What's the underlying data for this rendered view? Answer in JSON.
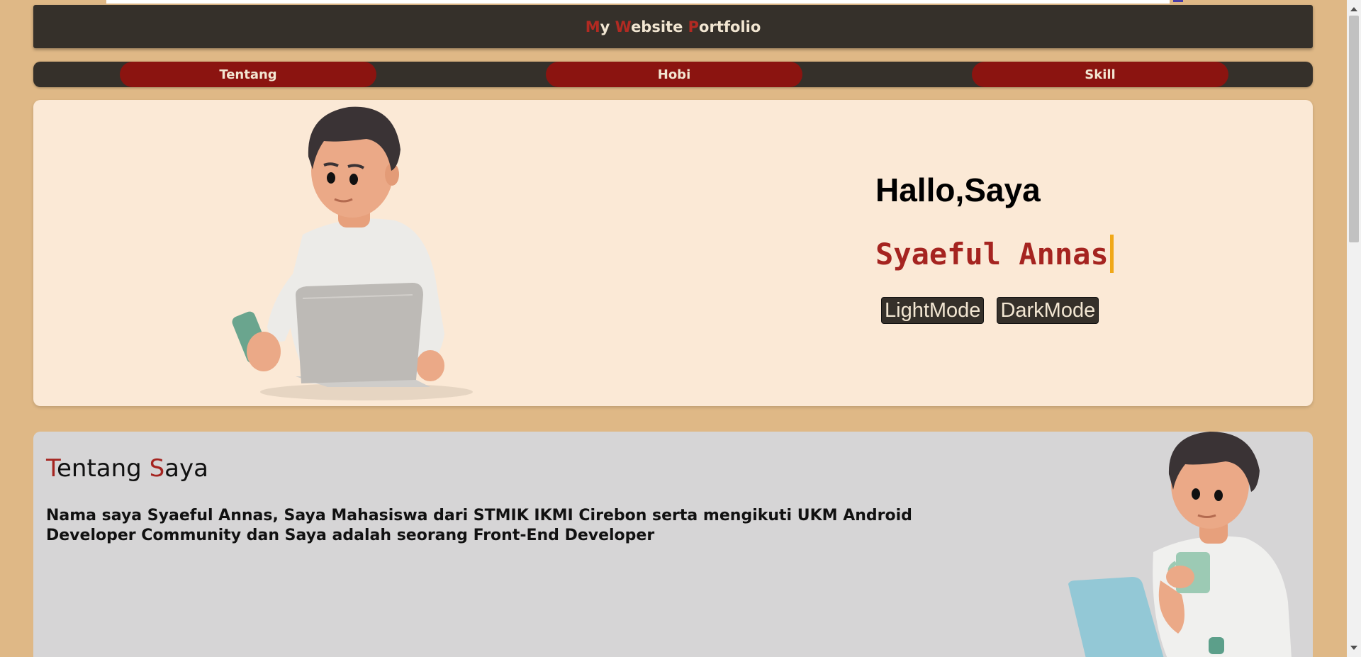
{
  "header": {
    "title_parts": [
      {
        "text": "M",
        "accent": true
      },
      {
        "text": "y ",
        "accent": false
      },
      {
        "text": "W",
        "accent": true
      },
      {
        "text": "ebsite ",
        "accent": false
      },
      {
        "text": "P",
        "accent": true
      },
      {
        "text": "ortfolio",
        "accent": false
      }
    ]
  },
  "nav": {
    "items": [
      {
        "label": "Tentang"
      },
      {
        "label": "Hobi"
      },
      {
        "label": "Skill"
      }
    ]
  },
  "hero": {
    "greeting": "Hallo,Saya",
    "name": "Syaeful Annas",
    "buttons": {
      "light": "LightMode",
      "dark": "DarkMode"
    }
  },
  "about": {
    "title_parts": [
      {
        "text": "T",
        "accent": true
      },
      {
        "text": "entang ",
        "accent": false
      },
      {
        "text": "S",
        "accent": true
      },
      {
        "text": "aya",
        "accent": false
      }
    ],
    "body": "Nama saya Syaeful Annas, Saya Mahasiswa dari STMIK IKMI Cirebon serta mengikuti UKM Android Developer Community dan Saya adalah seorang Front-End Developer"
  },
  "colors": {
    "page_bg": "#dfb886",
    "dark_bar": "#35302a",
    "nav_pill": "#8b1410",
    "accent_red": "#a52420",
    "hero_bg": "#fbe9d6",
    "about_bg": "#d6d5d6",
    "cursor": "#f0a818"
  },
  "icons": {
    "hero_illustration": "person-with-laptop-and-phone-illustration",
    "about_illustration": "person-with-laptop-and-mug-illustration"
  }
}
